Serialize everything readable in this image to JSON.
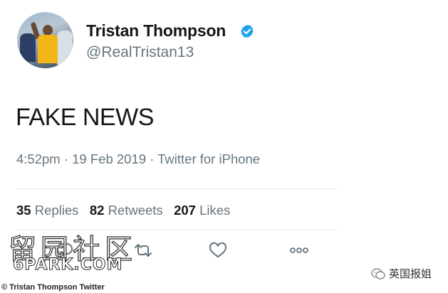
{
  "profile": {
    "name": "Tristan Thompson",
    "handle": "@RealTristan13"
  },
  "tweet": {
    "text": "FAKE NEWS",
    "meta": "4:52pm · 19 Feb 2019 · Twitter for iPhone"
  },
  "stats": {
    "replies_count": "35",
    "replies_label": "Replies",
    "retweets_count": "82",
    "retweets_label": "Retweets",
    "likes_count": "207",
    "likes_label": "Likes"
  },
  "icons": {
    "verified": "verified-badge-icon",
    "reply": "reply-icon",
    "retweet": "retweet-icon",
    "like": "heart-icon",
    "more": "more-dots-icon"
  },
  "watermark": {
    "chinese": "留园社区",
    "url": "6PARK.COM",
    "source": "英国报姐"
  },
  "caption": "© Tristan Thompson Twitter",
  "colors": {
    "text": "#14171a",
    "secondary": "#66757f",
    "verified": "#1da1f2",
    "divider": "#e1e8ed"
  }
}
